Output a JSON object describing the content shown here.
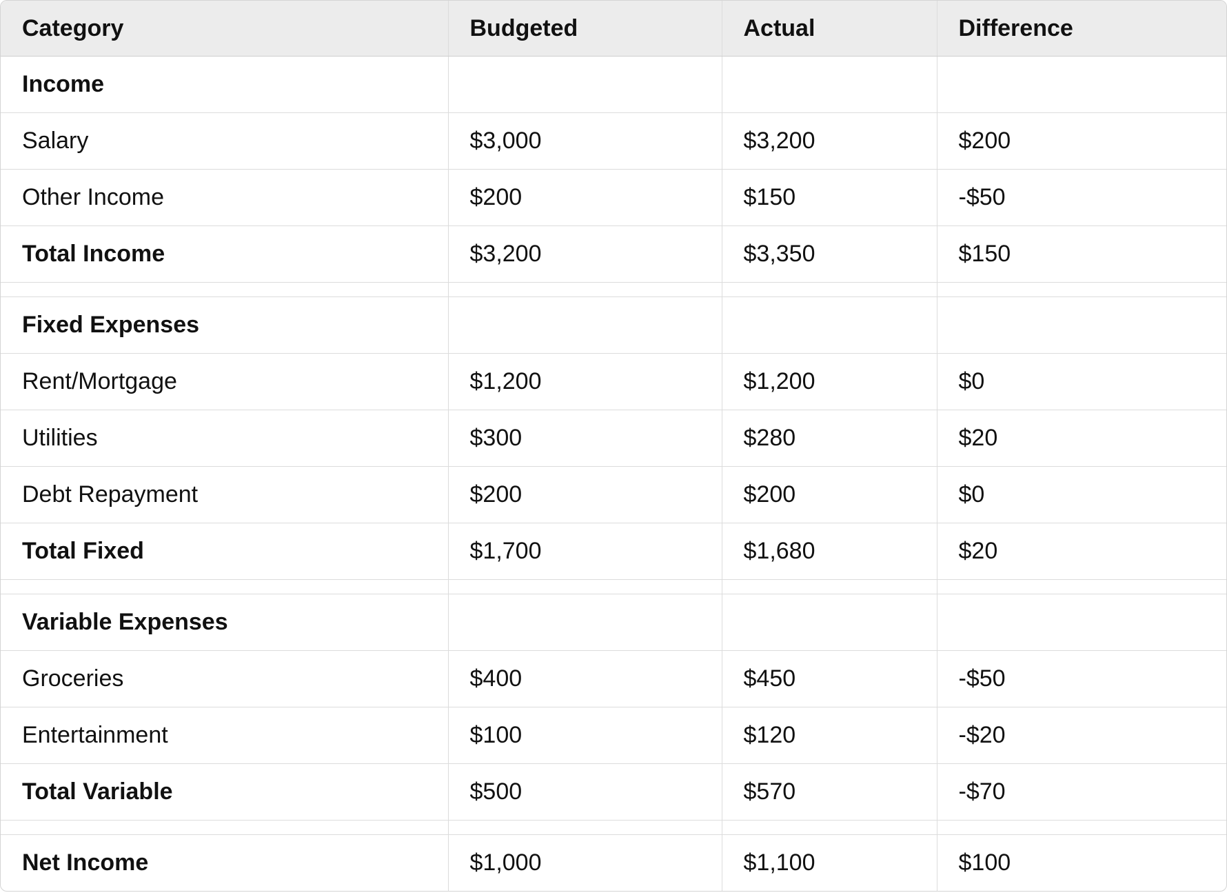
{
  "table": {
    "columns": [
      "Category",
      "Budgeted",
      "Actual",
      "Difference"
    ],
    "rows": [
      {
        "type": "section",
        "category": "Income",
        "budgeted": "",
        "actual": "",
        "difference": ""
      },
      {
        "type": "item",
        "category": "Salary",
        "budgeted": "$3,000",
        "actual": "$3,200",
        "difference": "$200"
      },
      {
        "type": "item",
        "category": "Other Income",
        "budgeted": "$200",
        "actual": "$150",
        "difference": "-$50"
      },
      {
        "type": "total",
        "category": "Total Income",
        "budgeted": "$3,200",
        "actual": "$3,350",
        "difference": "$150"
      },
      {
        "type": "spacer",
        "category": "",
        "budgeted": "",
        "actual": "",
        "difference": ""
      },
      {
        "type": "section",
        "category": "Fixed Expenses",
        "budgeted": "",
        "actual": "",
        "difference": ""
      },
      {
        "type": "item",
        "category": "Rent/Mortgage",
        "budgeted": "$1,200",
        "actual": "$1,200",
        "difference": "$0"
      },
      {
        "type": "item",
        "category": "Utilities",
        "budgeted": "$300",
        "actual": "$280",
        "difference": "$20"
      },
      {
        "type": "item",
        "category": "Debt Repayment",
        "budgeted": "$200",
        "actual": "$200",
        "difference": "$0"
      },
      {
        "type": "total",
        "category": "Total Fixed",
        "budgeted": "$1,700",
        "actual": "$1,680",
        "difference": "$20"
      },
      {
        "type": "spacer",
        "category": "",
        "budgeted": "",
        "actual": "",
        "difference": ""
      },
      {
        "type": "section",
        "category": "Variable Expenses",
        "budgeted": "",
        "actual": "",
        "difference": ""
      },
      {
        "type": "item",
        "category": "Groceries",
        "budgeted": "$400",
        "actual": "$450",
        "difference": "-$50"
      },
      {
        "type": "item",
        "category": "Entertainment",
        "budgeted": "$100",
        "actual": "$120",
        "difference": "-$20"
      },
      {
        "type": "total",
        "category": "Total Variable",
        "budgeted": "$500",
        "actual": "$570",
        "difference": "-$70"
      },
      {
        "type": "spacer",
        "category": "",
        "budgeted": "",
        "actual": "",
        "difference": ""
      },
      {
        "type": "total",
        "category": "Net Income",
        "budgeted": "$1,000",
        "actual": "$1,100",
        "difference": "$100"
      }
    ]
  }
}
